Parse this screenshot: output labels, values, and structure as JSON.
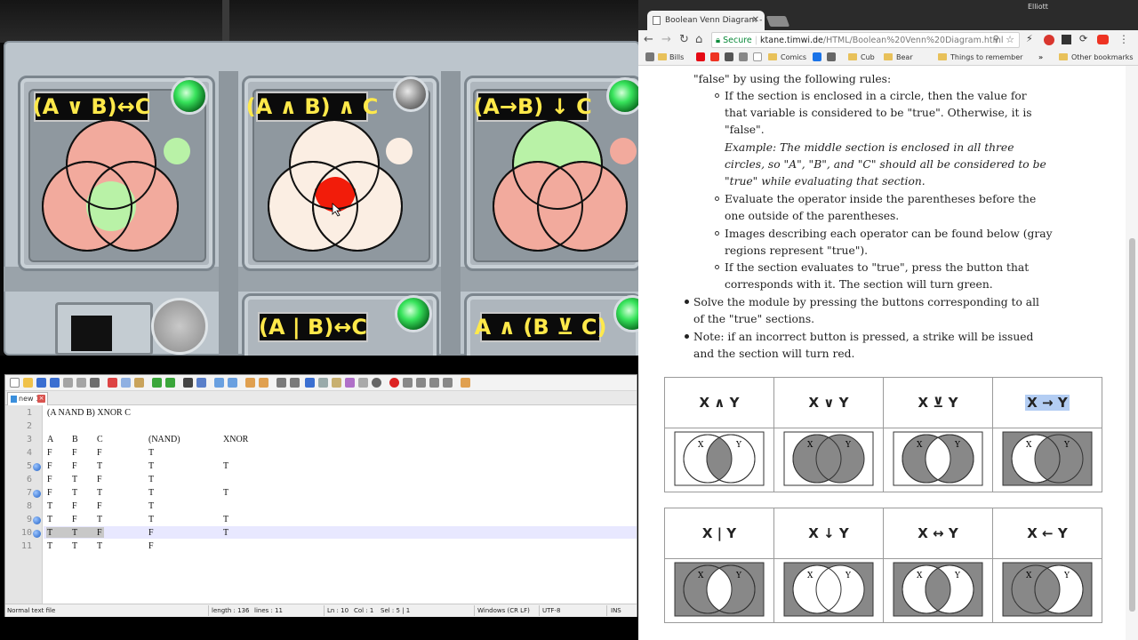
{
  "game": {
    "modules": [
      {
        "label": "(A ∨ B)↔C"
      },
      {
        "label": "(A ∧ B) ∧ C"
      },
      {
        "label": "(A→B) ↓ C"
      },
      {
        "label": "(A | B)↔C"
      },
      {
        "label": "A ∧ (B ⊻ C)"
      }
    ],
    "colors": {
      "pink": "#f2aa9d",
      "green": "#b9f2a7",
      "cream": "#fbeee3",
      "red": "#f21c0a",
      "lightgreen": "#c9f0ad"
    }
  },
  "notepad": {
    "tab_label": "new 1",
    "lines": [
      {
        "n": "1",
        "text": "(A NAND B) XNOR C"
      },
      {
        "n": "2",
        "text": ""
      },
      {
        "n": "3",
        "a": "A",
        "b": "B",
        "c": "C",
        "nand": "(NAND)",
        "xnor": "XNOR"
      },
      {
        "n": "4",
        "a": "F",
        "b": "F",
        "c": "F",
        "nand": "T",
        "xnor": ""
      },
      {
        "n": "5",
        "a": "F",
        "b": "F",
        "c": "T",
        "nand": "T",
        "xnor": "T"
      },
      {
        "n": "6",
        "a": "F",
        "b": "T",
        "c": "F",
        "nand": "T",
        "xnor": ""
      },
      {
        "n": "7",
        "a": "F",
        "b": "T",
        "c": "T",
        "nand": "T",
        "xnor": "T"
      },
      {
        "n": "8",
        "a": "T",
        "b": "F",
        "c": "F",
        "nand": "T",
        "xnor": ""
      },
      {
        "n": "9",
        "a": "T",
        "b": "F",
        "c": "T",
        "nand": "T",
        "xnor": "T"
      },
      {
        "n": "10",
        "a": "T",
        "b": "T",
        "c": "F",
        "nand": "F",
        "xnor": "T"
      },
      {
        "n": "11",
        "a": "T",
        "b": "T",
        "c": "T",
        "nand": "F",
        "xnor": ""
      }
    ],
    "status": {
      "type": "Normal text file",
      "length": "length : 136",
      "lines": "lines : 11",
      "pos": "Ln : 10",
      "col": "Col : 1",
      "sel": "Sel : 5 | 1",
      "eol": "Windows (CR LF)",
      "enc": "UTF-8",
      "mode": "INS"
    }
  },
  "browser": {
    "tab_title": "Boolean Venn Diagram -",
    "user": "Elliott",
    "url_secure": "Secure",
    "url_host": "ktane.timwi.de",
    "url_path": "/HTML/Boolean%20Venn%20Diagram.html",
    "bookmarks": [
      "Bills",
      "Comics",
      "Cub",
      "Bear",
      "Things to remember",
      "Other bookmarks"
    ],
    "content": {
      "line0": "\"false\" by using the following rules:",
      "r1a": "If the section is enclosed in a circle, then the value for",
      "r1b": "that variable is considered to be \"true\". Otherwise, it is",
      "r1c": "\"false\".",
      "ex1": "Example: The middle section is enclosed in all three",
      "ex2": "circles, so \"A\", \"B\", and \"C\" should all be considered to be",
      "ex3": "\"true\" while evaluating that section.",
      "r2a": "Evaluate the operator inside the parentheses before the",
      "r2b": "one outside of the parentheses.",
      "r3a": "Images describing each operator can be found below (gray",
      "r3b": "regions represent \"true\").",
      "r4a": "If the section evaluates to \"true\", press the button that",
      "r4b": "corresponds with it. The section will turn green.",
      "b1a": "Solve the module by pressing the buttons corresponding to all",
      "b1b": "of the \"true\" sections.",
      "b2a": "Note: if an incorrect button is pressed, a strike will be issued",
      "b2b": "and the section will turn red."
    },
    "operators_row1": [
      "X ∧ Y",
      "X ∨ Y",
      "X ⊻ Y",
      "X → Y"
    ],
    "operators_row2": [
      "X | Y",
      "X ↓ Y",
      "X ↔ Y",
      "X ← Y"
    ],
    "venn_labels": {
      "x": "X",
      "y": "Y"
    }
  }
}
